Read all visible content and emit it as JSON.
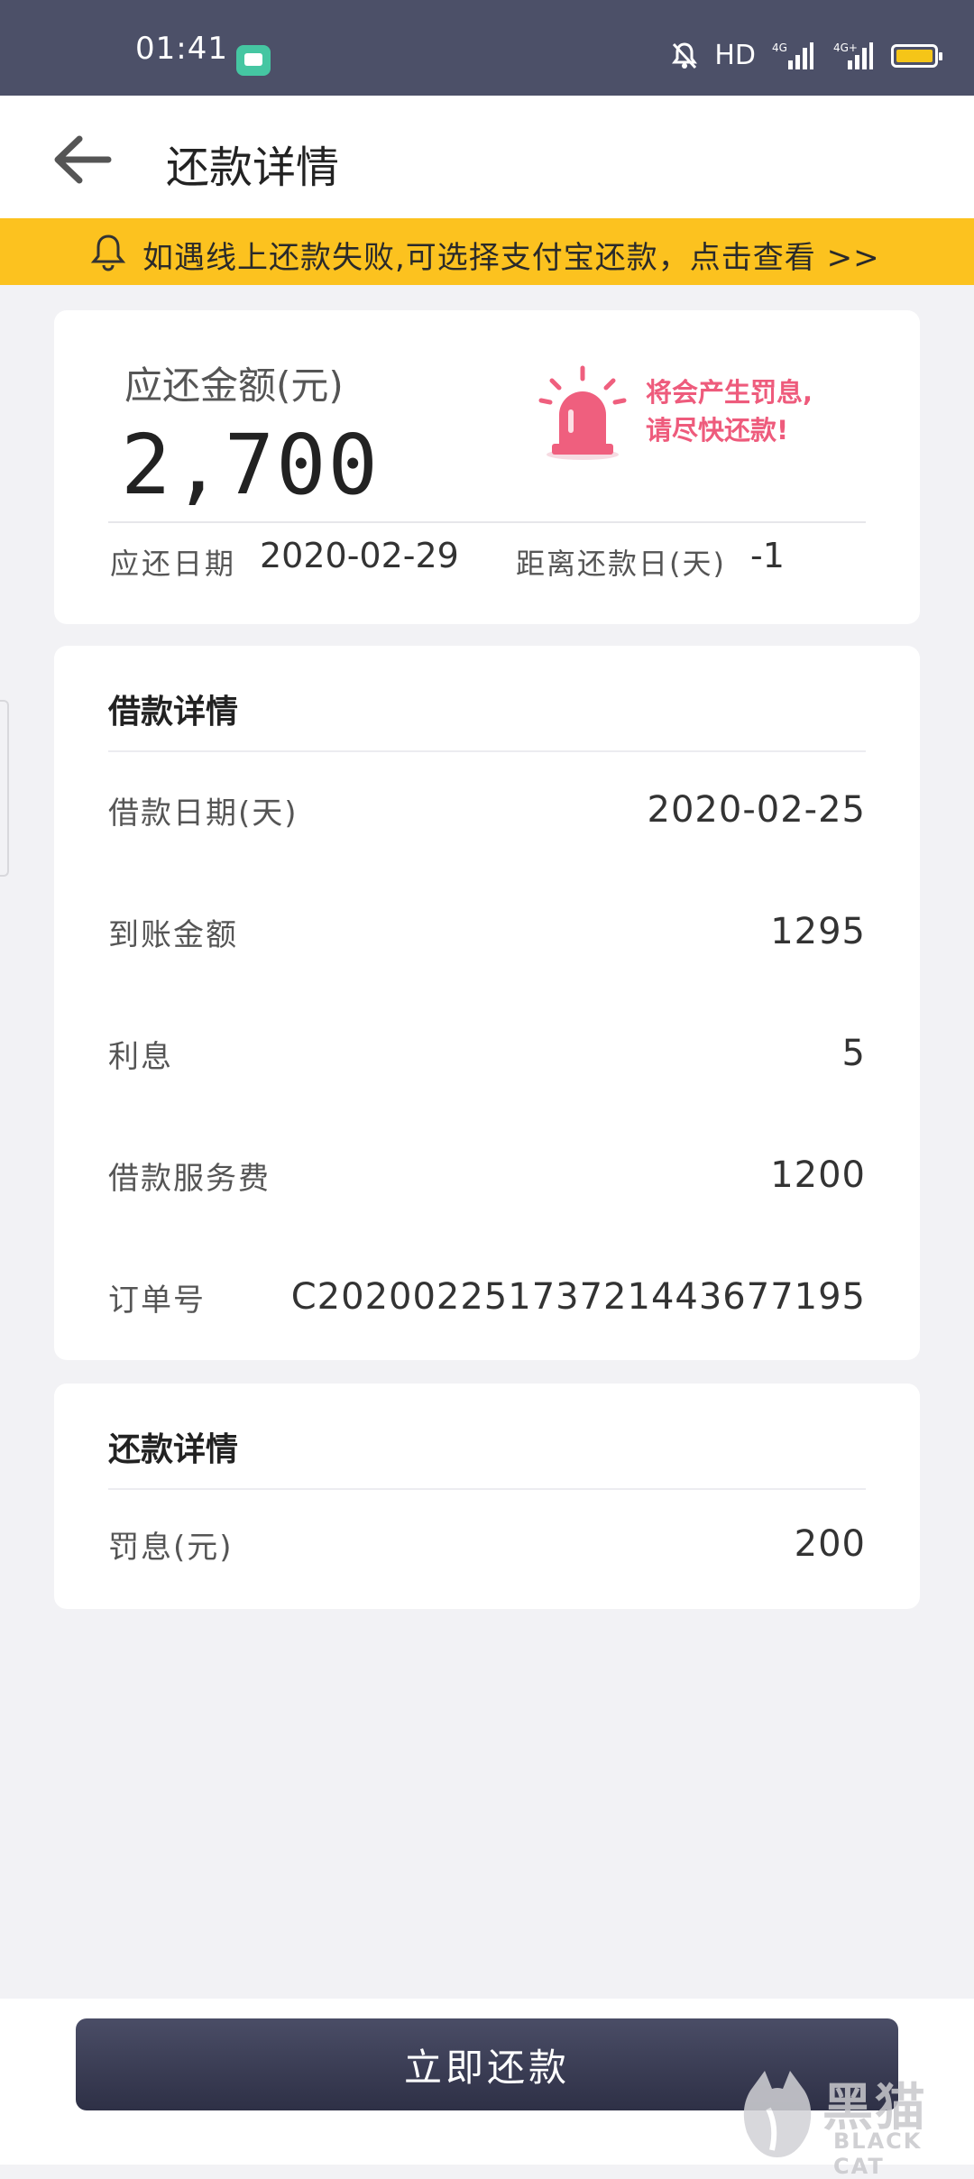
{
  "status_bar": {
    "time": "01:41",
    "network": "HD",
    "signal_1": "4G",
    "signal_2": "4G+"
  },
  "header": {
    "title": "还款详情"
  },
  "notice": {
    "text": "如遇线上还款失败,可选择支付宝还款，点击查看 >>"
  },
  "amount_card": {
    "amount_label": "应还金额(元)",
    "amount_value": "2,700",
    "warning_line1": "将会产生罚息,",
    "warning_line2": "请尽快还款!",
    "due_date_label": "应还日期",
    "due_date_value": "2020-02-29",
    "days_left_label": "距离还款日(天)",
    "days_left_value": "-1"
  },
  "loan_details": {
    "title": "借款详情",
    "rows": [
      {
        "label": "借款日期(天)",
        "value": "2020-02-25"
      },
      {
        "label": "到账金额",
        "value": "1295"
      },
      {
        "label": "利息",
        "value": "5"
      },
      {
        "label": "借款服务费",
        "value": "1200"
      },
      {
        "label": "订单号",
        "value": "C2020022517372144367719​5"
      }
    ]
  },
  "repay_details": {
    "title": "还款详情",
    "rows": [
      {
        "label": "罚息(元)",
        "value": "200"
      }
    ]
  },
  "bottom": {
    "repay_button": "立即还款"
  },
  "watermark": {
    "cn": "黑猫",
    "en": "BLACK CAT"
  },
  "colors": {
    "status_bar": "#4c5068",
    "notice_bg": "#fcc21f",
    "warning": "#ee5b7c",
    "button": "#2e3046"
  }
}
